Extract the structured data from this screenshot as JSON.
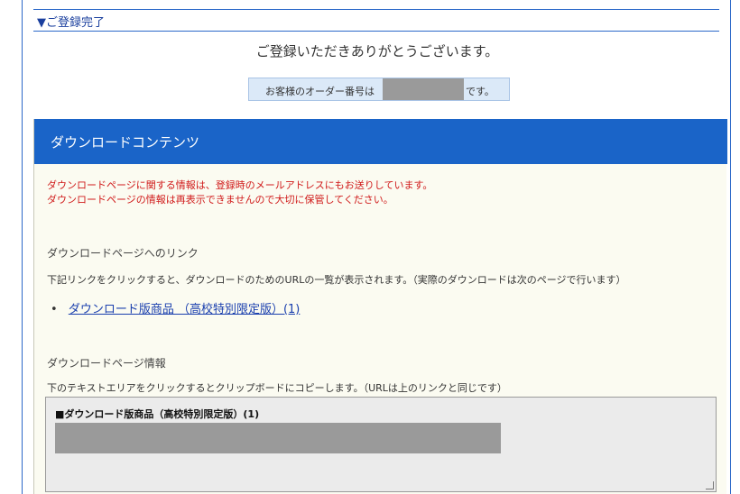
{
  "heading": {
    "label": "▼ご登録完了"
  },
  "thanks": "ご登録いただきありがとうございます。",
  "order": {
    "prefix": "お客様のオーダー番号は",
    "suffix": "です。"
  },
  "download": {
    "header": "ダウンロードコンテンツ",
    "notice_line1": "ダウンロードページに関する情報は、登録時のメールアドレスにもお送りしています。",
    "notice_line2": "ダウンロードページの情報は再表示できませんので大切に保管してください。",
    "link_section": {
      "title": "ダウンロードページへのリンク",
      "desc": "下記リンクをクリックすると、ダウンロードのためのURLの一覧が表示されます。（実際のダウンロードは次のページで行います）",
      "bullet": "•",
      "link_text": "ダウンロード版商品 （高校特別限定版）(1)"
    },
    "info_section": {
      "title": "ダウンロードページ情報",
      "desc": "下のテキストエリアをクリックするとクリップボードにコピーします。（URLは上のリンクと同じです）",
      "textarea_label": "■ダウンロード版商品（高校特別限定版）(1)"
    }
  }
}
